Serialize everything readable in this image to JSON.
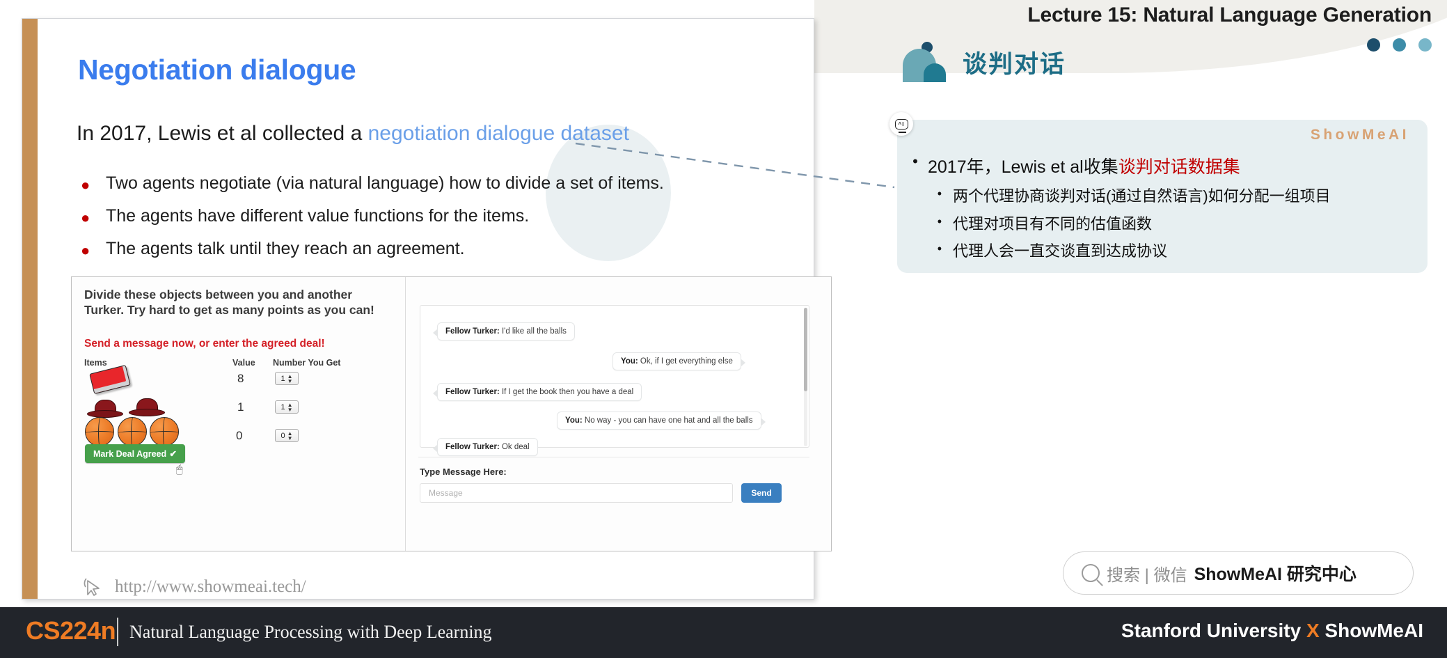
{
  "lecture": {
    "banner_title": "Lecture 15: Natural Language Generation",
    "dot_colors": [
      "#1d4e6b",
      "#3d8ca8",
      "#78b6c9"
    ]
  },
  "slide": {
    "title": "Negotiation dialogue",
    "lead_prefix": "In 2017, Lewis et al collected a ",
    "lead_highlight": "negotiation dialogue dataset",
    "bullets": [
      "Two agents negotiate (via natural language) how to divide a set of items.",
      "The agents have different value functions for the items.",
      "The agents talk until they reach an agreement."
    ],
    "watermark_url": "http://www.showmeai.tech/",
    "watermark_icon": "cursor-arrow-icon",
    "accent_bar_color": "#c69055",
    "title_color": "#3a7ced",
    "bullet_dot_color": "#c00000"
  },
  "screenshot": {
    "instructions": "Divide these objects between you and another Turker. Try hard to get as many points as you can!",
    "warning": "Send a message now, or enter the agreed deal!",
    "columns": {
      "items": "Items",
      "value": "Value",
      "number_you_get": "Number You Get"
    },
    "rows": [
      {
        "item": "book-icon",
        "value": "8",
        "count": "1"
      },
      {
        "item": "hat-icon",
        "value": "1",
        "count": "1"
      },
      {
        "item": "basketball-icon",
        "value": "0",
        "count": "0"
      }
    ],
    "mark_deal_label": "Mark Deal Agreed",
    "mark_deal_check": "✔",
    "mark_deal_color": "#46a04b",
    "chat": [
      {
        "speaker": "Fellow Turker:",
        "text": " I'd like all the balls",
        "side": "left"
      },
      {
        "speaker": "You:",
        "text": " Ok, if I get everything else",
        "side": "right"
      },
      {
        "speaker": "Fellow Turker:",
        "text": " If I get the book then you have a deal",
        "side": "left"
      },
      {
        "speaker": "You:",
        "text": " No way - you can have one hat and all the balls",
        "side": "right"
      },
      {
        "speaker": "Fellow Turker:",
        "text": " Ok deal",
        "side": "left"
      }
    ],
    "type_message_label": "Type Message Here:",
    "message_placeholder": "Message",
    "send_label": "Send",
    "send_color": "#3a7fc0"
  },
  "right_panel": {
    "heading": "谈判对话",
    "heading_color": "#1d6d86",
    "watermark": "ShowMeAI",
    "watermark_color": "#d8a273",
    "ai_badge_icon": "ai-robot-icon",
    "card_bg": "#e7eff1",
    "level1": {
      "bullet": "•",
      "text_plain": "2017年，Lewis et al收集",
      "text_red": "谈判对话数据集"
    },
    "level2": [
      "两个代理协商谈判对话(通过自然语言)如何分配一组项目",
      "代理对项目有不同的估值函数",
      "代理人会一直交谈直到达成协议"
    ],
    "level2_bullet": "•"
  },
  "search_bar": {
    "icon": "search-icon",
    "label_light": "搜索 | 微信",
    "label_bold": "ShowMeAI 研究中心"
  },
  "bottom_bar": {
    "course_code": "CS224n",
    "course_name": "Natural Language Processing with Deep Learning",
    "right_prefix": "Stanford University ",
    "right_x": "X",
    "right_suffix": " ShowMeAI",
    "bg": "#22252b",
    "accent": "#ef7c24"
  }
}
